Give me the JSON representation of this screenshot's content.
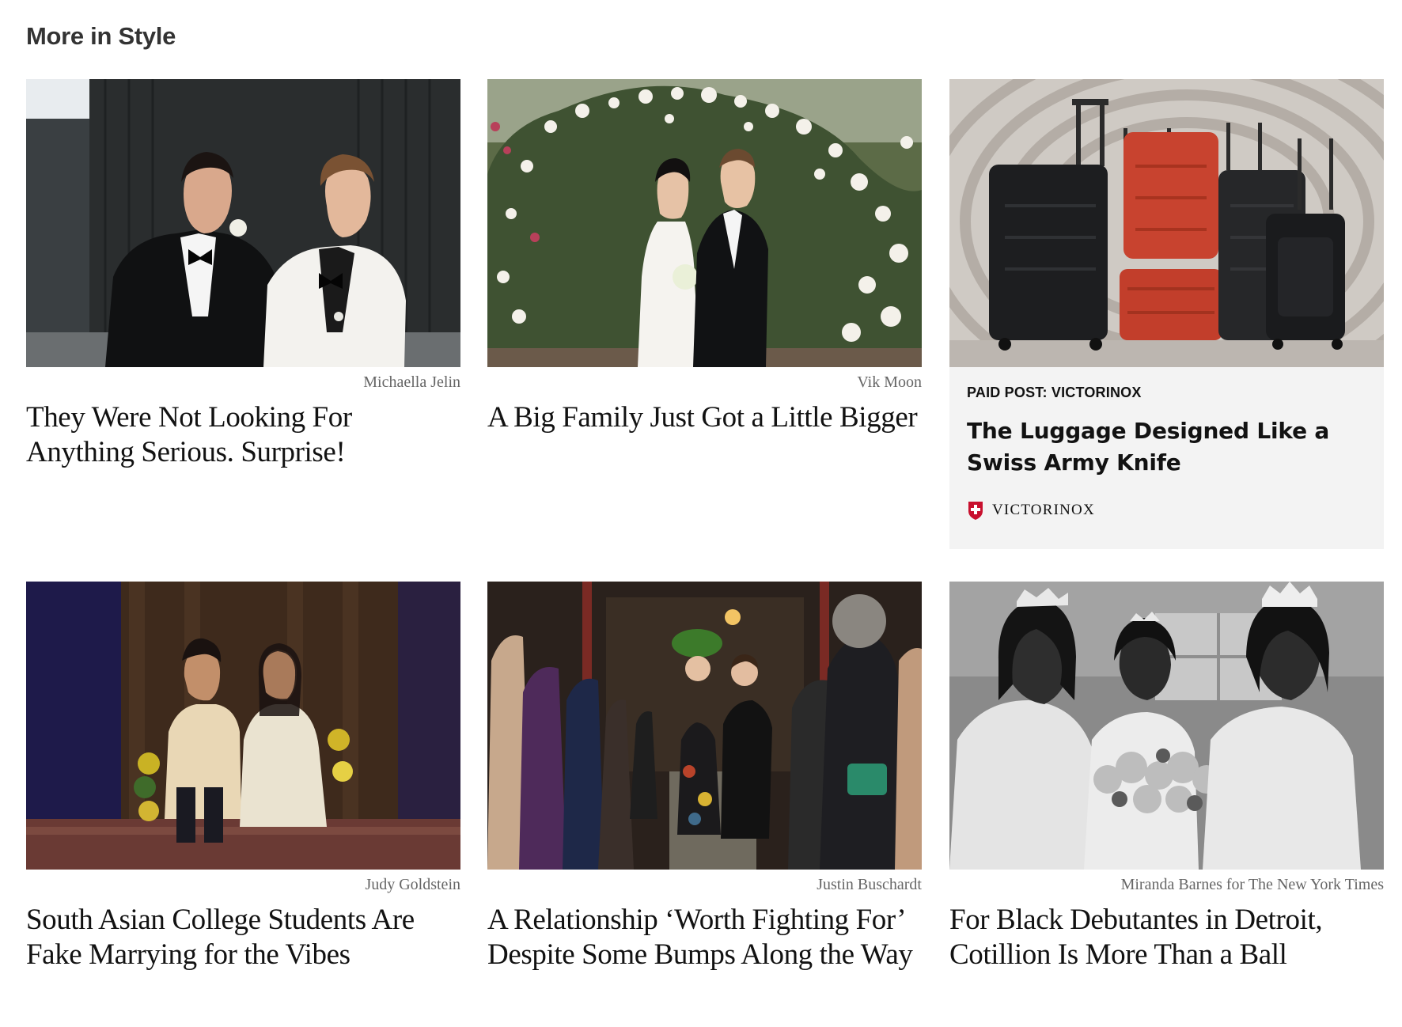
{
  "section": {
    "title": "More in Style"
  },
  "cards": [
    {
      "credit": "Michaella Jelin",
      "headline": "They Were Not Looking For Anything Serious. Surprise!"
    },
    {
      "credit": "Vik Moon",
      "headline": "A Big Family Just Got a Little Bigger"
    },
    {
      "label": "PAID POST: VICTORINOX",
      "headline": "The Luggage Designed Like a Swiss Army Knife",
      "brand": "VICTORINOX"
    },
    {
      "credit": "Judy Goldstein",
      "headline": "South Asian College Students Are Fake Marrying for the Vibes"
    },
    {
      "credit": "Justin Buschardt",
      "headline": "A Relationship ‘Worth Fighting For’ Despite Some Bumps Along the Way"
    },
    {
      "credit": "Miranda Barnes for The New York Times",
      "headline": "For Black Debutantes in Detroit, Cotillion Is More Than a Ball"
    }
  ],
  "colors": {
    "brand_red": "#c8102e",
    "paid_bg": "#f3f3f3",
    "credit_gray": "#666666"
  }
}
